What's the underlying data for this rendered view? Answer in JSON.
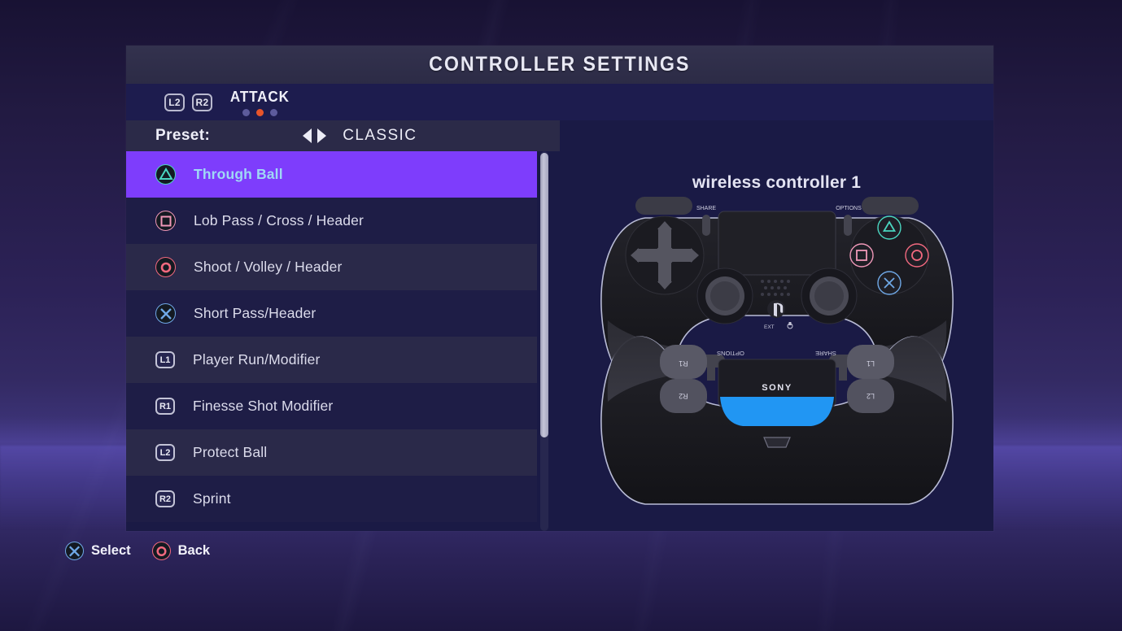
{
  "header": {
    "title": "CONTROLLER SETTINGS"
  },
  "tabbar": {
    "left_trigger": "L2",
    "right_trigger": "R2",
    "label": "ATTACK",
    "dots": [
      {
        "name": "page-dot-1",
        "active": false
      },
      {
        "name": "page-dot-2",
        "active": true
      },
      {
        "name": "page-dot-3",
        "active": false
      }
    ]
  },
  "preset": {
    "label": "Preset:",
    "value": "CLASSIC",
    "left_arrow": "left-arrow-icon",
    "right_arrow": "right-arrow-icon"
  },
  "bindings": [
    {
      "icon": "triangle-button-icon",
      "button": "triangle",
      "label": "Through Ball",
      "selected": true
    },
    {
      "icon": "square-button-icon",
      "button": "square",
      "label": "Lob Pass / Cross / Header",
      "selected": false
    },
    {
      "icon": "circle-button-icon",
      "button": "circle",
      "label": "Shoot / Volley / Header",
      "selected": false
    },
    {
      "icon": "cross-button-icon",
      "button": "cross",
      "label": "Short Pass/Header",
      "selected": false
    },
    {
      "icon": "l1-shoulder-icon",
      "button": "L1",
      "label": "Player Run/Modifier",
      "selected": false
    },
    {
      "icon": "r1-shoulder-icon",
      "button": "R1",
      "label": "Finesse Shot Modifier",
      "selected": false
    },
    {
      "icon": "l2-trigger-icon",
      "button": "L2",
      "label": "Protect Ball",
      "selected": false
    },
    {
      "icon": "r2-trigger-icon",
      "button": "R2",
      "label": "Sprint",
      "selected": false
    }
  ],
  "controller": {
    "title": "wireless controller 1",
    "front_labels": {
      "share": "SHARE",
      "options": "OPTIONS",
      "ext": "EXT"
    },
    "back_labels": {
      "brand": "SONY",
      "share": "SHARE",
      "options": "OPTIONS",
      "l1": "L1",
      "l2": "L2",
      "r1": "R1",
      "r2": "R2"
    }
  },
  "footer": [
    {
      "icon": "cross-button-icon",
      "button": "cross",
      "label": "Select"
    },
    {
      "icon": "circle-button-icon",
      "button": "circle",
      "label": "Back"
    }
  ],
  "colors": {
    "accent_selected": "#7e3dfc",
    "selected_text": "#9fd8f5",
    "dot_active": "#e8542a",
    "triangle": "#4ad6c0",
    "square": "#f098b8",
    "circle": "#f2697f",
    "cross": "#6fa8e6",
    "lightbar": "#2196f3",
    "panel_bg": "#1a1a45"
  },
  "scrollbar": {
    "thumb_fraction": 0.75
  }
}
